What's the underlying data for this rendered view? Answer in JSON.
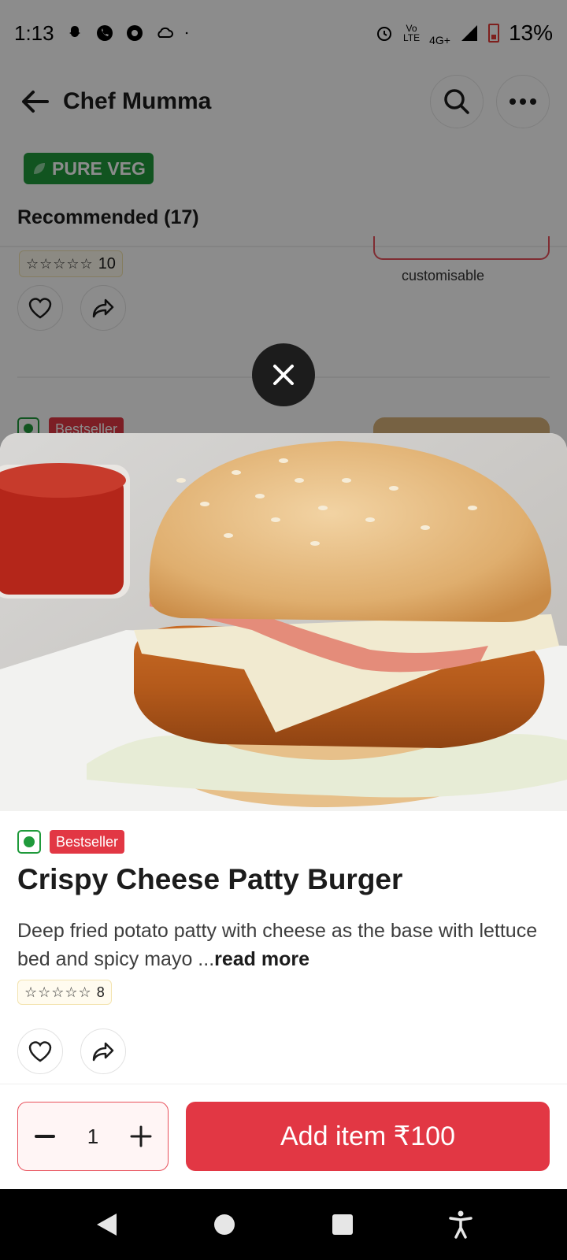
{
  "status_bar": {
    "time": "1:13",
    "network_top": "Vo",
    "network_bottom": "LTE",
    "network_type": "4G+",
    "battery": "13%"
  },
  "header": {
    "title": "Chef Mumma"
  },
  "badges": {
    "pure_veg": "PURE VEG"
  },
  "section": {
    "title": "Recommended (17)"
  },
  "background_item": {
    "rating_count": "10",
    "customisable": "customisable",
    "next_badge": "Bestseller"
  },
  "item": {
    "badge": "Bestseller",
    "title": "Crispy Cheese Patty Burger",
    "description": "Deep fried potato patty with cheese as the base with lettuce bed and spicy mayo ...",
    "read_more": "read more",
    "rating_count": "8"
  },
  "cart": {
    "quantity": "1",
    "add_label": "Add item ₹100"
  },
  "colors": {
    "brand": "#e23744",
    "veg": "#1f9a3b"
  }
}
